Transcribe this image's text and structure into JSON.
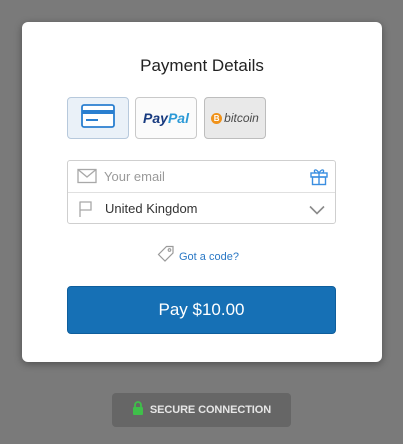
{
  "form": {
    "title": "Payment Details",
    "payment_methods": [
      {
        "name": "card",
        "icon": "credit-card-icon"
      },
      {
        "name": "paypal",
        "label_part1": "Pay",
        "label_part2": "Pal"
      },
      {
        "name": "bitcoin",
        "symbol": "B",
        "label": "bitcoin"
      }
    ],
    "email": {
      "placeholder": "Your email",
      "value": ""
    },
    "country": {
      "value": "United Kingdom"
    },
    "code_link": "Got a code?",
    "pay_button": "Pay $10.00"
  },
  "footer": {
    "secure_label": "SECURE CONNECTION"
  },
  "colors": {
    "accent": "#1670b5",
    "link": "#2a78c5",
    "secure_lock": "#3fbf4a",
    "bitcoin": "#f0921a"
  }
}
